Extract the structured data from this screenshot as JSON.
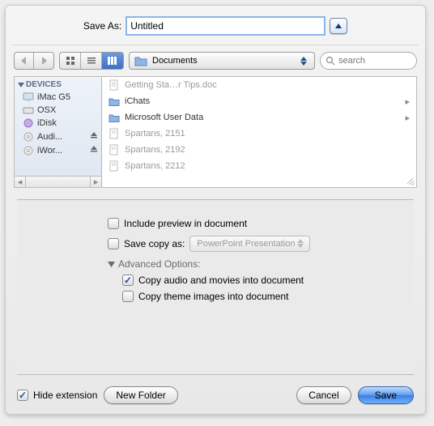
{
  "saveas": {
    "label": "Save As:",
    "value": "Untitled"
  },
  "toolbar": {
    "location": "Documents",
    "search_placeholder": "search"
  },
  "sidebar": {
    "header": "DEVICES",
    "items": [
      {
        "label": "iMac G5",
        "icon": "imac"
      },
      {
        "label": "OSX",
        "icon": "hd"
      },
      {
        "label": "iDisk",
        "icon": "idisk"
      },
      {
        "label": "Audi...",
        "icon": "disc",
        "eject": true
      },
      {
        "label": "iWor...",
        "icon": "disc",
        "eject": true
      }
    ]
  },
  "column": {
    "items": [
      {
        "label": "Getting Sta…r Tips.doc",
        "type": "doc",
        "dim": true
      },
      {
        "label": "iChats",
        "type": "folder",
        "arrow": true
      },
      {
        "label": "Microsoft User Data",
        "type": "folder",
        "arrow": true
      },
      {
        "label": "Spartans, 2151",
        "type": "doc",
        "dim": true
      },
      {
        "label": "Spartans, 2192",
        "type": "doc",
        "dim": true
      },
      {
        "label": "Spartans, 2212",
        "type": "doc",
        "dim": true
      }
    ]
  },
  "options": {
    "include_preview": "Include preview in document",
    "save_copy_as": "Save copy as:",
    "format": "PowerPoint Presentation",
    "advanced": "Advanced Options:",
    "copy_av": "Copy audio and movies into document",
    "copy_theme": "Copy theme images into document"
  },
  "bottom": {
    "hide_ext": "Hide extension",
    "new_folder": "New Folder",
    "cancel": "Cancel",
    "save": "Save"
  }
}
